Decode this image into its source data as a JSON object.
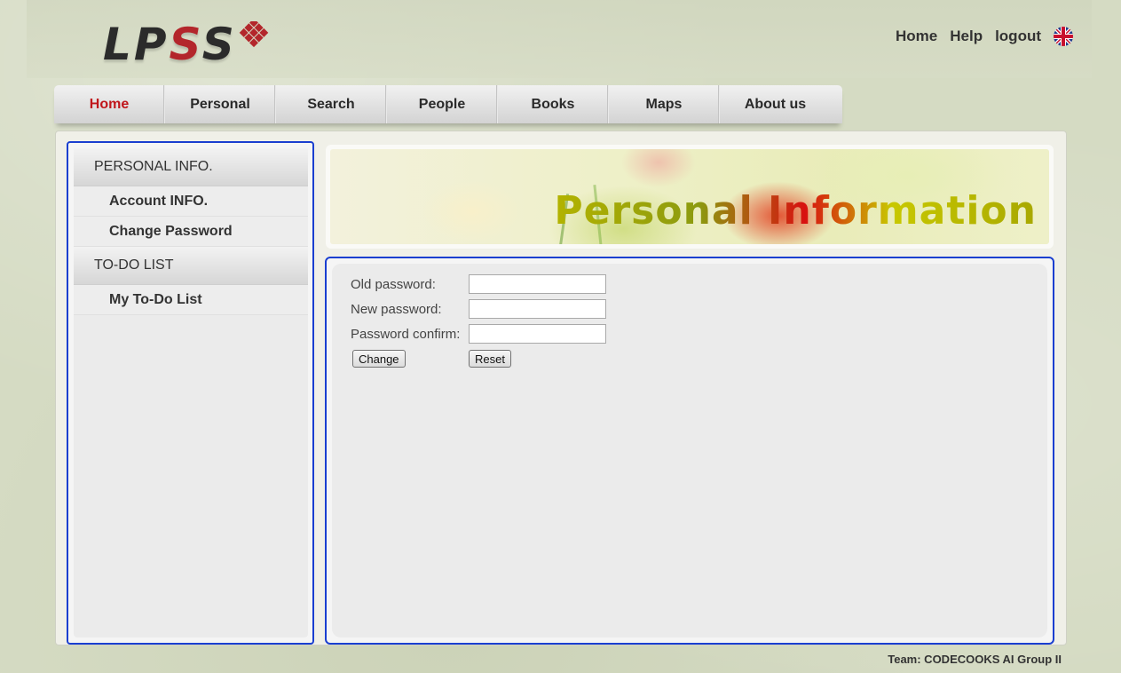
{
  "logo": {
    "text_a": "LP",
    "text_b": "S",
    "text_c": "S"
  },
  "top_links": {
    "home": "Home",
    "help": "Help",
    "logout": "logout",
    "language_icon": "uk-flag-icon"
  },
  "nav": {
    "items": [
      {
        "label": "Home",
        "active": true
      },
      {
        "label": "Personal"
      },
      {
        "label": "Search"
      },
      {
        "label": "People"
      },
      {
        "label": "Books"
      },
      {
        "label": "Maps"
      },
      {
        "label": "About us"
      }
    ],
    "active_color": "#c0161b"
  },
  "sidebar": {
    "sections": [
      {
        "heading": "PERSONAL INFO.",
        "items": [
          "Account INFO.",
          "Change Password"
        ]
      },
      {
        "heading": "TO-DO LIST",
        "items": [
          "My To-Do List"
        ]
      }
    ]
  },
  "banner": {
    "title": "Personal Information"
  },
  "form": {
    "old_password_label": "Old password:",
    "new_password_label": "New password:",
    "confirm_label": "Password confirm:",
    "old_password_value": "",
    "new_password_value": "",
    "confirm_value": "",
    "change_button": "Change",
    "reset_button": "Reset"
  },
  "footer": {
    "text": "Team: CODECOOKS AI Group II"
  },
  "colors": {
    "frame_border": "#1a3fd0",
    "accent_red": "#b3262b"
  }
}
